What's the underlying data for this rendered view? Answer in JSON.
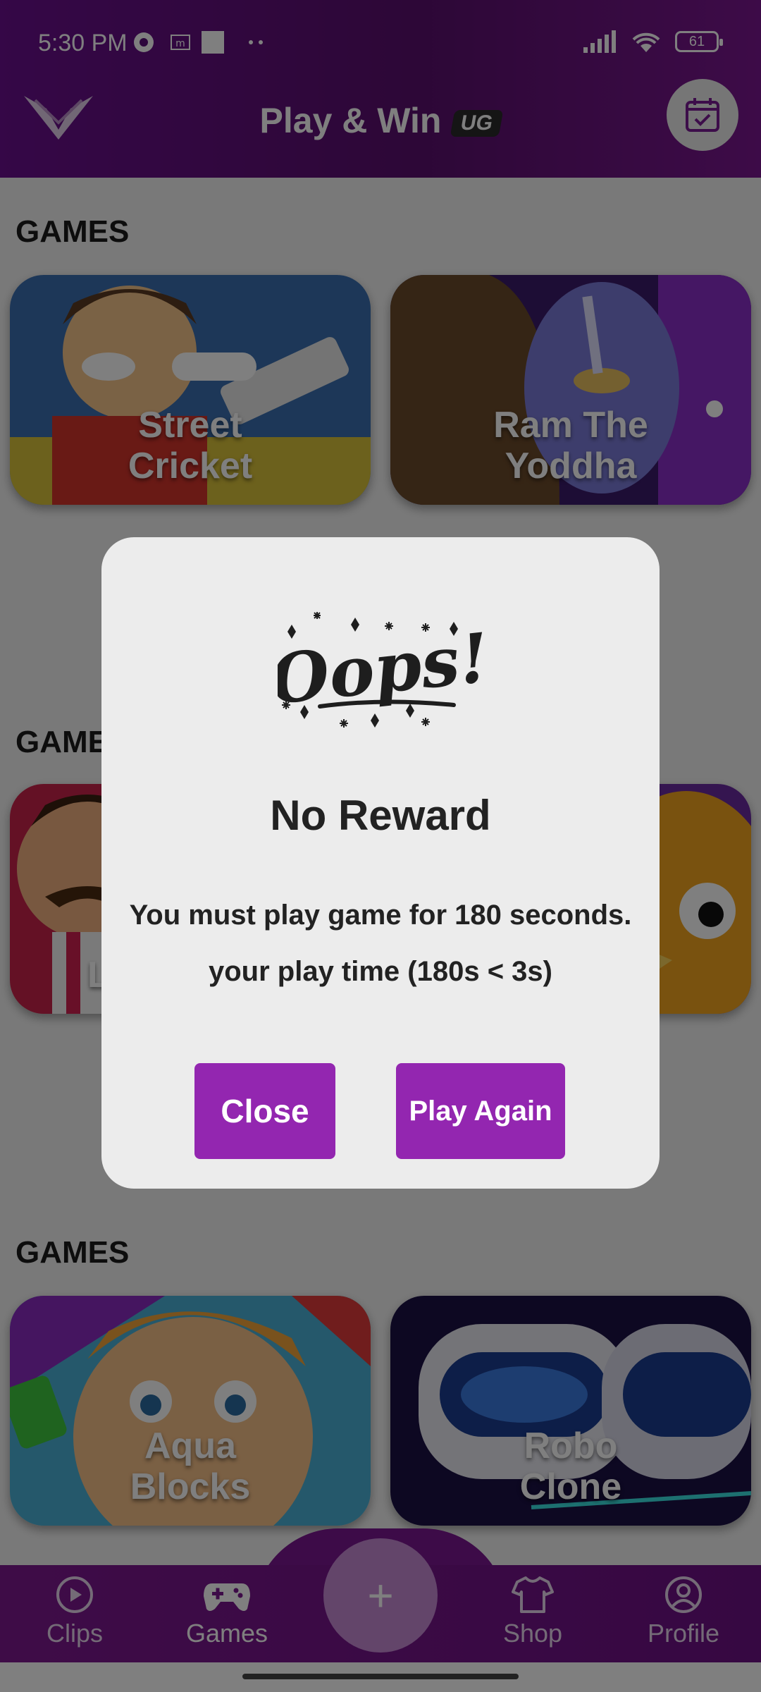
{
  "status_bar": {
    "time": "5:30 PM",
    "battery": "61"
  },
  "header": {
    "title": "Play & Win",
    "badge": "UG"
  },
  "sections": [
    {
      "title": "GAMES",
      "games": [
        "Street Cricket",
        "Ram The Yoddha"
      ]
    },
    {
      "title": "GAMES",
      "games": [
        "L",
        ""
      ]
    },
    {
      "title": "GAMES",
      "games": [
        "Aqua Blocks",
        "Robo Clone"
      ]
    }
  ],
  "cards": {
    "street_cricket": {
      "line1": "Street",
      "line2": "Cricket"
    },
    "ram_yoddha": {
      "line1": "Ram The",
      "line2": "Yoddha"
    },
    "aqua_blocks": {
      "line1": "Aqua",
      "line2": "Blocks"
    },
    "robo_clone": {
      "line1": "Robo",
      "line2": "Clone"
    },
    "partial_left": {
      "line1": "L"
    }
  },
  "section_titles": {
    "s1": "GAMES",
    "s2": "GAMES",
    "s3": "GAMES"
  },
  "dialog": {
    "image_text": "Oops!",
    "title": "No Reward",
    "message_line1": "You must play game for 180 seconds.",
    "message_line2": "your play time (180s < 3s)",
    "close_label": "Close",
    "play_again_label": "Play Again"
  },
  "bottom_nav": {
    "clips": "Clips",
    "games": "Games",
    "add": "+",
    "shop": "Shop",
    "profile": "Profile"
  },
  "colors": {
    "header_purple": "#6a0f8e",
    "button_purple": "#9326b0",
    "nav_purple": "#7d188f"
  }
}
